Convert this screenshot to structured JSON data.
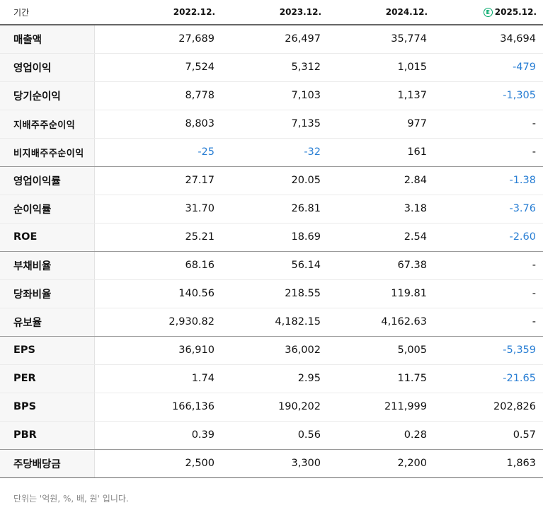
{
  "header": {
    "label": "기간",
    "periods": [
      "2022.12.",
      "2023.12.",
      "2024.12.",
      "2025.12."
    ],
    "estimate_icon": "E",
    "estimate_color": "#03a96b"
  },
  "colors": {
    "negative": "#2a7fd4"
  },
  "rows": [
    {
      "label": "매출액",
      "values": [
        "27,689",
        "26,497",
        "35,774",
        "34,694"
      ]
    },
    {
      "label": "영업이익",
      "values": [
        "7,524",
        "5,312",
        "1,015",
        "-479"
      ]
    },
    {
      "label": "당기순이익",
      "values": [
        "8,778",
        "7,103",
        "1,137",
        "-1,305"
      ]
    },
    {
      "label": "지배주주순이익",
      "values": [
        "8,803",
        "7,135",
        "977",
        "-"
      ]
    },
    {
      "label": "비지배주주순이익",
      "values": [
        "-25",
        "-32",
        "161",
        "-"
      ]
    },
    {
      "label": "영업이익률",
      "values": [
        "27.17",
        "20.05",
        "2.84",
        "-1.38"
      ]
    },
    {
      "label": "순이익률",
      "values": [
        "31.70",
        "26.81",
        "3.18",
        "-3.76"
      ]
    },
    {
      "label": "ROE",
      "values": [
        "25.21",
        "18.69",
        "2.54",
        "-2.60"
      ]
    },
    {
      "label": "부채비율",
      "values": [
        "68.16",
        "56.14",
        "67.38",
        "-"
      ]
    },
    {
      "label": "당좌비율",
      "values": [
        "140.56",
        "218.55",
        "119.81",
        "-"
      ]
    },
    {
      "label": "유보율",
      "values": [
        "2,930.82",
        "4,182.15",
        "4,162.63",
        "-"
      ]
    },
    {
      "label": "EPS",
      "values": [
        "36,910",
        "36,002",
        "5,005",
        "-5,359"
      ]
    },
    {
      "label": "PER",
      "values": [
        "1.74",
        "2.95",
        "11.75",
        "-21.65"
      ]
    },
    {
      "label": "BPS",
      "values": [
        "166,136",
        "190,202",
        "211,999",
        "202,826"
      ]
    },
    {
      "label": "PBR",
      "values": [
        "0.39",
        "0.56",
        "0.28",
        "0.57"
      ]
    },
    {
      "label": "주당배당금",
      "values": [
        "2,500",
        "3,300",
        "2,200",
        "1,863"
      ]
    }
  ],
  "footnote": "단위는 '억원, %, 배, 원' 입니다."
}
